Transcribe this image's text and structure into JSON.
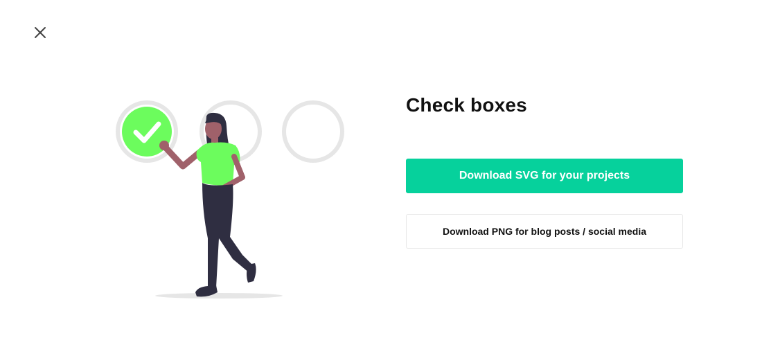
{
  "dialog": {
    "title": "Check boxes",
    "primary_button": "Download SVG for your projects",
    "secondary_button": "Download PNG for blog posts / social media"
  },
  "icons": {
    "close": "close-icon",
    "checkmark": "check-icon"
  },
  "colors": {
    "accent": "#06d19c",
    "illustration_green": "#6cfc5d",
    "circle_gray": "#e6e6e6",
    "figure_dark": "#2f2e41",
    "skin": "#a0616a"
  }
}
